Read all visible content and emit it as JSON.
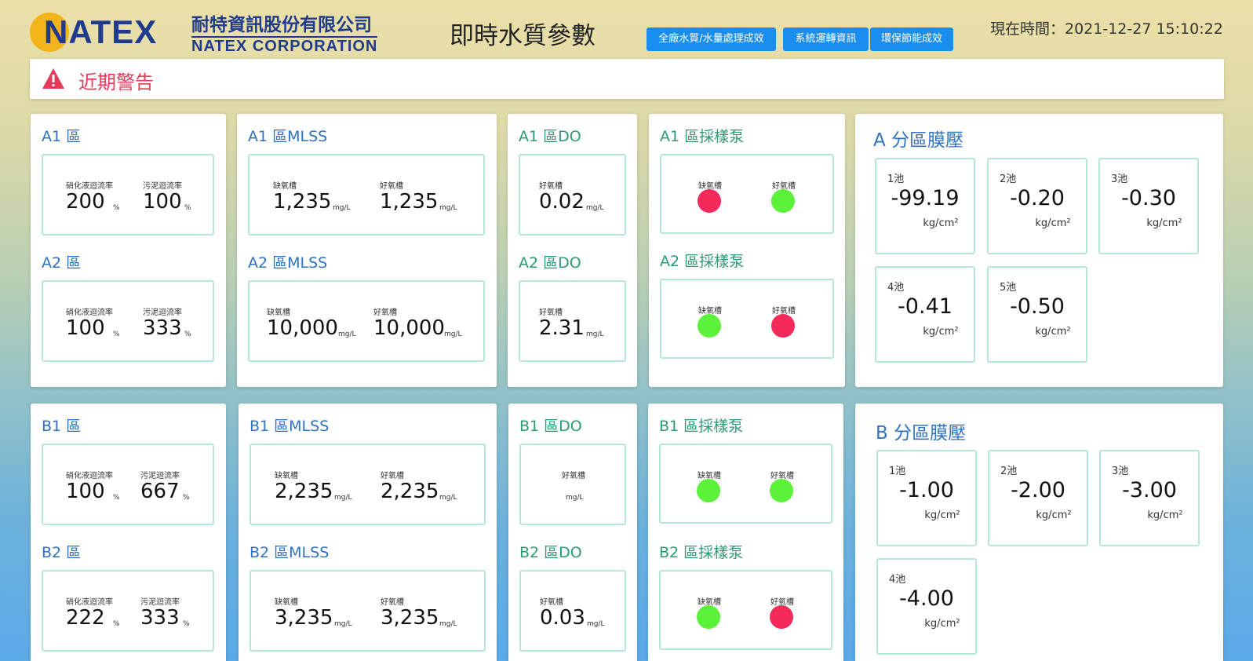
{
  "header": {
    "logo_word": "NATEX",
    "logo_cn": "耐特資訊股份有限公司",
    "logo_en": "NATEX CORPORATION",
    "title": "即時水質參數",
    "nav": [
      "全廠水質/水量處理成效",
      "系統運轉資訊",
      "環保節能成效"
    ],
    "clock": "現在時間：2021-12-27 15:10:22"
  },
  "alert": {
    "text": "近期警告"
  },
  "labels": {
    "nitrate_rate": "硝化液迴流率",
    "sludge_rate": "污泥迴流率",
    "anoxic": "缺氧槽",
    "aerobic": "好氧槽",
    "percent": "%",
    "mgl": "mg/L",
    "kgcm": "kg/cm²"
  },
  "colors": {
    "pump_on": "#5cf23a",
    "pump_off": "#f32a5a",
    "nav_button": "#1a8ef0",
    "alert_text": "#e63a5a"
  },
  "zone": {
    "A1": {
      "title": "A1 區",
      "nitrate": "200",
      "sludge": "100"
    },
    "A2": {
      "title": "A2 區",
      "nitrate": "100",
      "sludge": "333"
    },
    "B1": {
      "title": "B1 區",
      "nitrate": "100",
      "sludge": "667"
    },
    "B2": {
      "title": "B2 區",
      "nitrate": "222",
      "sludge": "333"
    }
  },
  "mlss": {
    "A1": {
      "title": "A1 區MLSS",
      "anoxic": "1,235",
      "aerobic": "1,235"
    },
    "A2": {
      "title": "A2 區MLSS",
      "anoxic": "10,000",
      "aerobic": "10,000"
    },
    "B1": {
      "title": "B1 區MLSS",
      "anoxic": "2,235",
      "aerobic": "2,235"
    },
    "B2": {
      "title": "B2 區MLSS",
      "anoxic": "3,235",
      "aerobic": "3,235"
    }
  },
  "do": {
    "A1": {
      "title": "A1 區DO",
      "aerobic": "0.02"
    },
    "A2": {
      "title": "A2 區DO",
      "aerobic": "2.31"
    },
    "B1": {
      "title": "B1 區DO",
      "aerobic": ""
    },
    "B2": {
      "title": "B2 區DO",
      "aerobic": "0.03"
    }
  },
  "pump": {
    "A1": {
      "title": "A1 區採樣泵",
      "anoxic": "off",
      "aerobic": "on"
    },
    "A2": {
      "title": "A2 區採樣泵",
      "anoxic": "on",
      "aerobic": "off"
    },
    "B1": {
      "title": "B1 區採樣泵",
      "anoxic": "on",
      "aerobic": "on"
    },
    "B2": {
      "title": "B2 區採樣泵",
      "anoxic": "on",
      "aerobic": "off"
    }
  },
  "membrane": {
    "A": {
      "title": "A 分區膜壓",
      "pools": [
        {
          "name": "1池",
          "value": "-99.19"
        },
        {
          "name": "2池",
          "value": "-0.20"
        },
        {
          "name": "3池",
          "value": "-0.30"
        },
        {
          "name": "4池",
          "value": "-0.41"
        },
        {
          "name": "5池",
          "value": "-0.50"
        }
      ]
    },
    "B": {
      "title": "B 分區膜壓",
      "pools": [
        {
          "name": "1池",
          "value": "-1.00"
        },
        {
          "name": "2池",
          "value": "-2.00"
        },
        {
          "name": "3池",
          "value": "-3.00"
        },
        {
          "name": "4池",
          "value": "-4.00"
        }
      ]
    }
  }
}
